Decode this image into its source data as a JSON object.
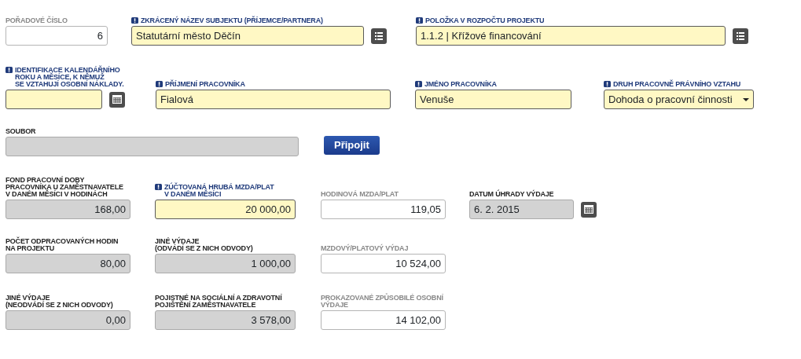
{
  "rows": [
    [
      {
        "kind": "calculated",
        "label": "POŘADOVÉ ČÍSLO",
        "value": "6",
        "required": false,
        "numeric": true
      },
      {
        "kind": "editable",
        "label": "ZKRÁCENÝ NÁZEV SUBJEKTU (PŘÍJEMCE/PARTNERA)",
        "value": "Statutární město Děčín",
        "required": true,
        "numeric": false,
        "list_button": true
      },
      {
        "kind": "editable",
        "label": "POLOŽKA V ROZPOČTU PROJEKTU",
        "value": "1.1.2 | Křížové financování",
        "required": true,
        "numeric": false,
        "list_button": true
      }
    ],
    [
      {
        "kind": "editable",
        "label": "IDENTIFIKACE KALENDÁŘNÍHO\nROKU A MĚSÍCE, K NĚMUŽ\nSE VZTAHUJÍ OSOBNÍ NÁKLADY.",
        "required": true,
        "calendar_button": true
      },
      {
        "kind": "editable",
        "label": "PŘÍJMENÍ PRACOVNÍKA",
        "value": "Fialová",
        "required": true,
        "numeric": false
      },
      {
        "kind": "editable",
        "label": "JMÉNO PRACOVNÍKA",
        "value": "Venuše",
        "required": true,
        "numeric": false
      },
      {
        "kind": "editable",
        "label": "DRUH PRACOVNĚ PRÁVNÍHO VZTAHU",
        "value": "Dohoda o pracovní činnosti",
        "required": true,
        "numeric": false,
        "dropdown": true
      }
    ],
    [
      {
        "kind": "readonly",
        "label": "SOUBOR",
        "required": false
      },
      {
        "kind": "button",
        "label": "Připojit"
      }
    ],
    [
      {
        "kind": "readonly",
        "label": "FOND PRACOVNÍ DOBY\nPRACOVNÍKA U ZAMĚSTNAVATELE\nV DANÉM MĚSÍCI V HODINÁCH",
        "value": "168,00",
        "required": false,
        "numeric": true
      },
      {
        "kind": "editable",
        "label": "ZÚČTOVANÁ HRUBÁ MZDA/PLAT\nV DANÉM MĚSÍCI",
        "value": "20 000,00",
        "required": true,
        "numeric": true
      },
      {
        "kind": "calculated",
        "label": "HODINOVÁ MZDA/PLAT",
        "value": "119,05",
        "required": false,
        "numeric": true
      },
      {
        "kind": "readonly",
        "label": "DATUM ÚHRADY VÝDAJE",
        "value": "6. 2. 2015",
        "required": false,
        "numeric": false,
        "calendar_button": true
      }
    ],
    [
      {
        "kind": "readonly",
        "label": "POČET ODPRACOVANÝCH HODIN\nNA PROJEKTU",
        "value": "80,00",
        "required": false,
        "numeric": true
      },
      {
        "kind": "readonly",
        "label": "JINÉ VÝDAJE\n(ODVÁDÍ SE Z NICH ODVODY)",
        "value": "1 000,00",
        "required": false,
        "numeric": true
      },
      {
        "kind": "calculated",
        "label": "MZDOVÝ/PLATOVÝ VÝDAJ",
        "value": "10 524,00",
        "required": false,
        "numeric": true
      }
    ],
    [
      {
        "kind": "readonly",
        "label": "JINÉ VÝDAJE\n(NEODVÁDÍ SE Z NICH ODVODY)",
        "value": "0,00",
        "required": false,
        "numeric": true
      },
      {
        "kind": "readonly",
        "label": "POJISTNÉ NA SOCIÁLNÍ A ZDRAVOTNÍ\nPOJIŠTĚNÍ ZAMĚSTNAVATELE",
        "value": "3 578,00",
        "required": false,
        "numeric": true
      },
      {
        "kind": "calculated",
        "label": "PROKAZOVANÉ ZPŮSOBILÉ OSOBNÍ\nVÝDAJE",
        "value": "14 102,00",
        "required": false,
        "numeric": true
      }
    ]
  ]
}
